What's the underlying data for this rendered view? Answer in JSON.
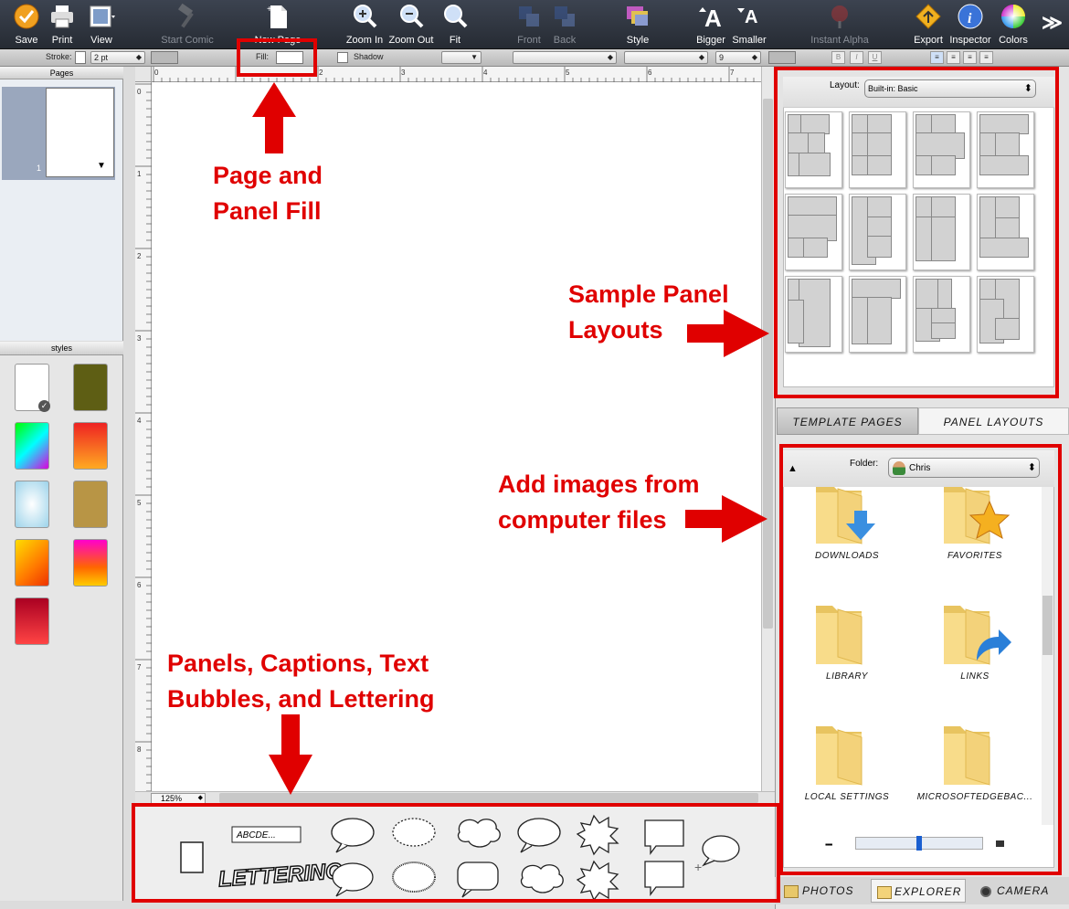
{
  "toolbar": {
    "items": [
      {
        "label": "Save",
        "icon": "save-icon"
      },
      {
        "label": "Print",
        "icon": "printer-icon"
      },
      {
        "label": "View",
        "icon": "view-icon"
      },
      {
        "label": "Start Comic",
        "icon": "hammer-icon"
      },
      {
        "label": "New Page",
        "icon": "new-page-icon"
      },
      {
        "label": "Zoom In",
        "icon": "zoom-in-icon"
      },
      {
        "label": "Zoom Out",
        "icon": "zoom-out-icon"
      },
      {
        "label": "Fit",
        "icon": "fit-icon"
      },
      {
        "label": "Front",
        "icon": "front-icon"
      },
      {
        "label": "Back",
        "icon": "back-icon"
      },
      {
        "label": "Style",
        "icon": "style-icon"
      },
      {
        "label": "Bigger",
        "icon": "bigger-font-icon"
      },
      {
        "label": "Smaller",
        "icon": "smaller-font-icon"
      },
      {
        "label": "Instant Alpha",
        "icon": "instant-alpha-icon"
      },
      {
        "label": "Export",
        "icon": "export-icon"
      },
      {
        "label": "Inspector",
        "icon": "inspector-icon"
      },
      {
        "label": "Colors",
        "icon": "colors-icon"
      }
    ],
    "more": "≫"
  },
  "format_bar": {
    "stroke_label": "Stroke:",
    "stroke_width": "2 pt",
    "fill_label": "Fill:",
    "shadow_label": "Shadow",
    "font_size": "9",
    "bold": "B",
    "italic": "I",
    "underline": "U"
  },
  "pages_panel": {
    "title": "Pages",
    "page_number": "1"
  },
  "styles_panel": {
    "title": "styles"
  },
  "ruler": {
    "h_labels": [
      "0",
      "1",
      "2",
      "3",
      "4",
      "5",
      "6",
      "7"
    ],
    "v_labels": [
      "0",
      "1",
      "2",
      "3",
      "4",
      "5",
      "6",
      "7",
      "8"
    ]
  },
  "zoom": {
    "value": "125%"
  },
  "palette": {
    "caption_text": "ABCDE...",
    "lettering_text": "LETTERING"
  },
  "layout_panel": {
    "label": "Layout:",
    "selected": "Built-in: Basic"
  },
  "tabs": {
    "template_pages": "TEMPLATE PAGES",
    "panel_layouts": "PANEL LAYOUTS"
  },
  "explorer": {
    "folder_label": "Folder:",
    "folder_value": "Chris",
    "folders": [
      {
        "label": "DOWNLOADS",
        "icon": "downloads-folder-icon"
      },
      {
        "label": "FAVORITES",
        "icon": "favorites-folder-icon"
      },
      {
        "label": "LIBRARY",
        "icon": "folder-icon"
      },
      {
        "label": "LINKS",
        "icon": "links-folder-icon"
      },
      {
        "label": "LOCAL SETTINGS",
        "icon": "folder-icon"
      },
      {
        "label": "MICROSOFTEDGEBAC...",
        "icon": "folder-icon"
      }
    ]
  },
  "bottom_tabs": {
    "photos": "PHOTOS",
    "explorer": "EXPLORER",
    "camera": "CAMERA"
  },
  "annotations": {
    "fill": [
      "Page and",
      "Panel Fill"
    ],
    "layouts": [
      "Sample Panel",
      "Layouts"
    ],
    "images": [
      "Add images from",
      "computer files"
    ],
    "panels": [
      "Panels, Captions, Text",
      "Bubbles, and Lettering"
    ]
  },
  "colors": {
    "annotation_red": "#e00000",
    "toolbar_bg": "#2f353f"
  }
}
